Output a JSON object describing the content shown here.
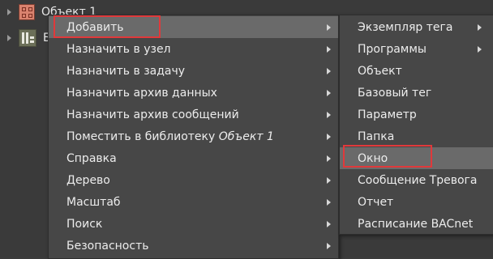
{
  "tree": {
    "items": [
      {
        "label": "Объект 1",
        "icon": "object-icon",
        "expanded": false
      },
      {
        "label": "Би",
        "icon": "library-icon",
        "expanded": false
      }
    ]
  },
  "context_menu": {
    "items": [
      {
        "label": "Добавить",
        "has_submenu": true,
        "active": true
      },
      {
        "label": "Назначить в узел",
        "has_submenu": true
      },
      {
        "label": "Назначить в задачу",
        "has_submenu": true
      },
      {
        "label": "Назначить архив данных",
        "has_submenu": true
      },
      {
        "label": "Назначить архив сообщений",
        "has_submenu": true
      },
      {
        "label": "Поместить в библиотеку",
        "label_italic": "Объект 1",
        "has_submenu": true
      },
      {
        "label": "Справка",
        "has_submenu": true
      },
      {
        "label": "Дерево",
        "has_submenu": true
      },
      {
        "label": "Масштаб",
        "has_submenu": true
      },
      {
        "label": "Поиск",
        "has_submenu": true
      },
      {
        "label": "Безопасность",
        "has_submenu": true
      }
    ]
  },
  "submenu": {
    "items": [
      {
        "label": "Экземпляр тега",
        "has_submenu": true
      },
      {
        "label": "Программы",
        "has_submenu": true
      },
      {
        "label": "Объект",
        "has_submenu": false
      },
      {
        "label": "Базовый тег",
        "has_submenu": false
      },
      {
        "label": "Параметр",
        "has_submenu": false
      },
      {
        "label": "Папка",
        "has_submenu": false
      },
      {
        "label": "Окно",
        "has_submenu": false,
        "active": true
      },
      {
        "label": "Сообщение Тревога",
        "has_submenu": false
      },
      {
        "label": "Отчет",
        "has_submenu": false
      },
      {
        "label": "Расписание BACnet",
        "has_submenu": false
      }
    ]
  },
  "colors": {
    "highlight_border": "#e0393b",
    "menu_bg": "#474747",
    "active_item_bg": "#6a6a6a"
  }
}
